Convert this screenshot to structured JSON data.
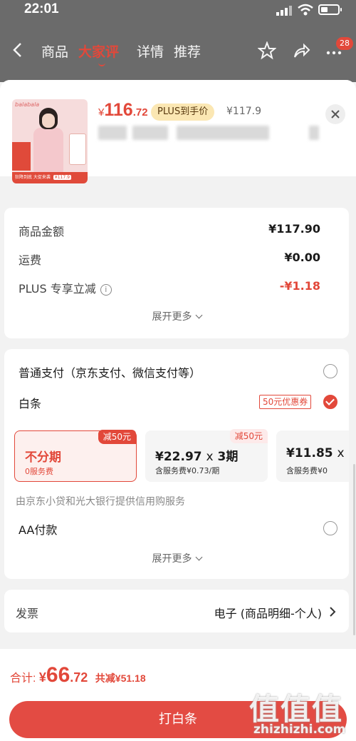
{
  "status_bar": {
    "time": "22:01"
  },
  "nav": {
    "tabs": [
      {
        "label": "商品"
      },
      {
        "label": "大家评",
        "active": true
      },
      {
        "label": "详情"
      },
      {
        "label": "推荐"
      }
    ],
    "badge": "28",
    "icons": [
      "back-icon",
      "star-icon",
      "share-icon",
      "more-icon"
    ]
  },
  "product": {
    "price_symbol": "¥",
    "price_int": "116",
    "price_dec": ".72",
    "plus_label": "PLUS到手价",
    "original_price": "¥117.9",
    "thumb_brand": "balabala",
    "thumb_strip": "狂降到底 大促来袭",
    "thumb_strip_price": "¥117.9"
  },
  "summary": {
    "rows": [
      {
        "label": "商品金额",
        "value": "¥117.90"
      },
      {
        "label": "运费",
        "value": "¥0.00"
      },
      {
        "label": "PLUS 专享立减",
        "value": "-¥1.18",
        "red": true
      }
    ],
    "more_label": "展开更多"
  },
  "payment": {
    "normal_label": "普通支付（京东支付、微信支付等）",
    "baitiao_label": "白条",
    "coupon_label": "50元优惠券",
    "plans": [
      {
        "tag": "减50元",
        "title": "不分期",
        "sub": "0服务费",
        "selected": true
      },
      {
        "tag": "减50元",
        "title_amount": "¥22.97",
        "title_mult": "x",
        "title_period": "3期",
        "sub": "含服务费¥0.73/期"
      },
      {
        "title_amount": "¥11.85",
        "title_mult": "x",
        "sub": "含服务费¥0"
      }
    ],
    "provider_note": "由京东小贷和光大银行提供信用购服务",
    "aa_label": "AA付款",
    "more_label": "展开更多"
  },
  "invoice": {
    "label": "发票",
    "value": "电子 (商品明细-个人)"
  },
  "footer": {
    "total_label": "合计:",
    "total_symbol": "¥",
    "total_int": "66",
    "total_dec": ".72",
    "saved": "共减¥51.18",
    "pay_button": "打白条"
  },
  "watermark": {
    "big": "值值值",
    "small": "zhizhizhi.com"
  },
  "colors": {
    "accent": "#e2483a",
    "plus_bg": "#fbe7b3",
    "sheet_bg": "#f2f2f2"
  }
}
